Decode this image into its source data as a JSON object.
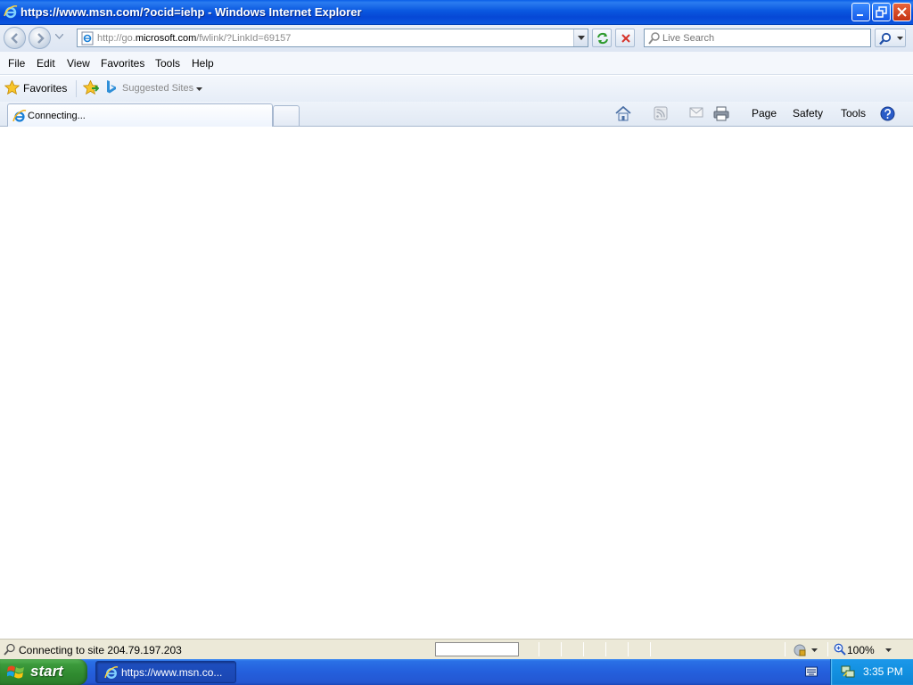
{
  "window": {
    "title": "https://www.msn.com/?ocid=iehp - Windows Internet Explorer"
  },
  "address": {
    "url_prefix": "http://go.",
    "url_host": "microsoft.com",
    "url_path": "/fwlink/?LinkId=69157"
  },
  "search": {
    "placeholder": "Live Search"
  },
  "menu": {
    "items": [
      "File",
      "Edit",
      "View",
      "Favorites",
      "Tools",
      "Help"
    ]
  },
  "favorites_bar": {
    "favorites_label": "Favorites",
    "suggested_sites_label": "Suggested Sites"
  },
  "tabs": [
    {
      "label": "Connecting..."
    }
  ],
  "command_bar": {
    "page_label": "Page",
    "safety_label": "Safety",
    "tools_label": "Tools"
  },
  "status": {
    "text": "Connecting to site 204.79.197.203",
    "zoom": "100%"
  },
  "taskbar": {
    "start_label": "start",
    "task_label": "https://www.msn.co...",
    "clock": "3:35 PM"
  },
  "colors": {
    "titlebar": "#0a58e0",
    "taskbar": "#245fdc",
    "start_button": "#3c9a3c",
    "tray": "#1290e0"
  }
}
